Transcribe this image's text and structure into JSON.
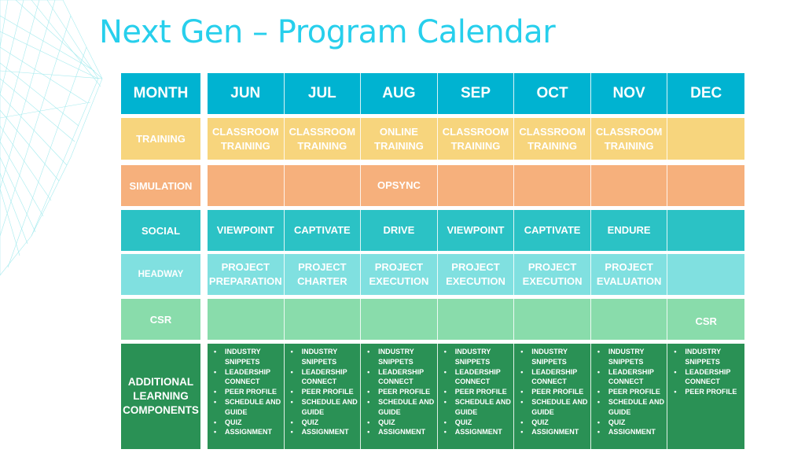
{
  "title": "Next Gen – Program Calendar",
  "month_label": "MONTH",
  "months": [
    "JUN",
    "JUL",
    "AUG",
    "SEP",
    "OCT",
    "NOV",
    "DEC"
  ],
  "rows": {
    "training": {
      "label": "TRAINING",
      "cells": [
        "CLASSROOM TRAINING",
        "CLASSROOM TRAINING",
        "ONLINE TRAINING",
        "CLASSROOM TRAINING",
        "CLASSROOM TRAINING",
        "CLASSROOM TRAINING",
        ""
      ]
    },
    "simulation": {
      "label": "SIMULATION",
      "cells": [
        "",
        "",
        "OPSYNC",
        "",
        "",
        "",
        ""
      ]
    },
    "social": {
      "label": "SOCIAL",
      "cells": [
        "VIEWPOINT",
        "CAPTIVATE",
        "DRIVE",
        "VIEWPOINT",
        "CAPTIVATE",
        "ENDURE",
        ""
      ]
    },
    "headway": {
      "label": "HEADWAY",
      "cells": [
        "PROJECT PREPARATION",
        "PROJECT CHARTER",
        "PROJECT EXECUTION",
        "PROJECT EXECUTION",
        "PROJECT EXECUTION",
        "PROJECT EVALUATION",
        ""
      ]
    },
    "csr": {
      "label": "CSR",
      "cells": [
        "",
        "",
        "",
        "",
        "",
        "",
        "CSR"
      ]
    },
    "additional": {
      "label": "ADDITIONAL LEARNING COMPONENTS",
      "cells": [
        [
          "INDUSTRY SNIPPETS",
          "LEADERSHIP CONNECT",
          "PEER PROFILE",
          "SCHEDULE AND GUIDE",
          "QUIZ",
          "ASSIGNMENT"
        ],
        [
          "INDUSTRY SNIPPETS",
          "LEADERSHIP CONNECT",
          "PEER PROFILE",
          "SCHEDULE AND GUIDE",
          "QUIZ",
          "ASSIGNMENT"
        ],
        [
          "INDUSTRY SNIPPETS",
          "LEADERSHIP CONNECT",
          "PEER PROFILE",
          "SCHEDULE AND GUIDE",
          "QUIZ",
          "ASSIGNMENT"
        ],
        [
          "INDUSTRY SNIPPETS",
          "LEADERSHIP CONNECT",
          "PEER PROFILE",
          "SCHEDULE AND GUIDE",
          "QUIZ",
          "ASSIGNMENT"
        ],
        [
          "INDUSTRY SNIPPETS",
          "LEADERSHIP CONNECT",
          "PEER PROFILE",
          "SCHEDULE AND GUIDE",
          "QUIZ",
          "ASSIGNMENT"
        ],
        [
          "INDUSTRY SNIPPETS",
          "LEADERSHIP CONNECT",
          "PEER PROFILE",
          "SCHEDULE AND GUIDE",
          "QUIZ",
          "ASSIGNMENT"
        ],
        [
          "INDUSTRY SNIPPETS",
          "LEADERSHIP CONNECT",
          "PEER PROFILE"
        ]
      ]
    }
  },
  "colors": {
    "title": "#27cfec",
    "month": "#00b3d1",
    "training": "#f7d57d",
    "simulation": "#f6b07c",
    "social": "#2bc2c5",
    "headway": "#80e0e0",
    "csr": "#89dcab",
    "additional": "#2a9155"
  }
}
